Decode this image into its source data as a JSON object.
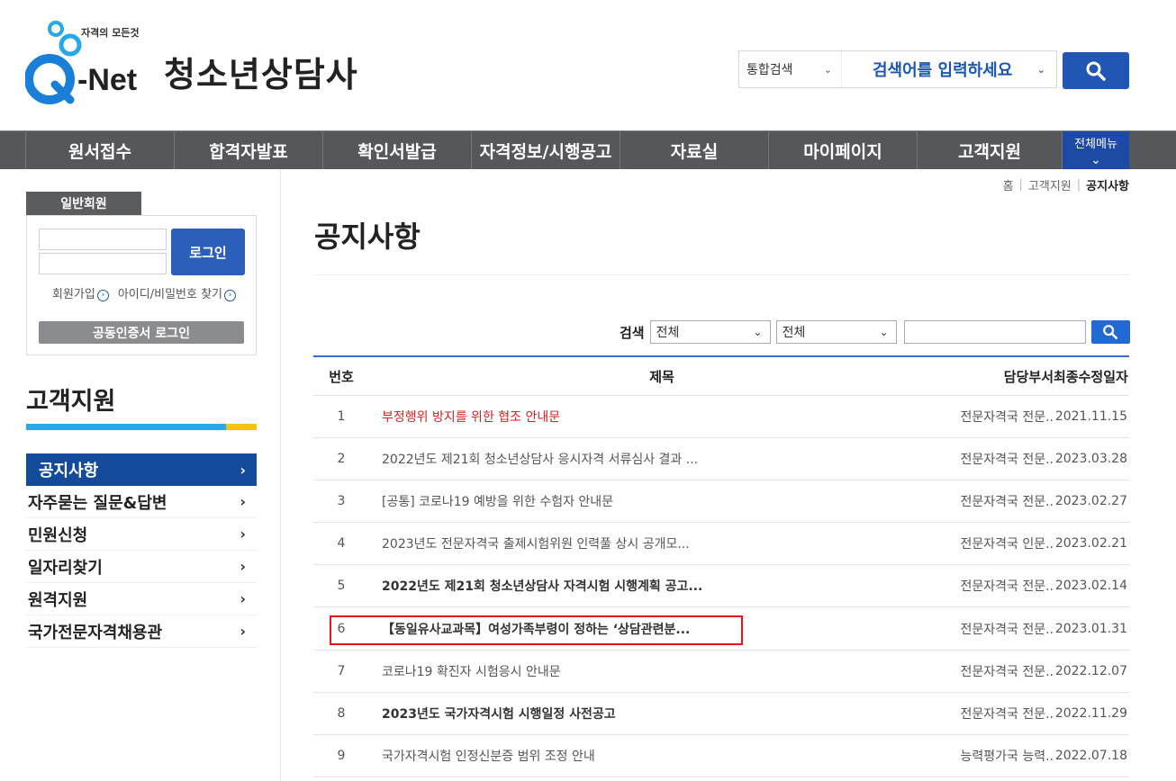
{
  "logo": {
    "tagline": "자격의 모든것",
    "wordmark": "Q-Net",
    "alt": "Q-Net"
  },
  "site_title": "청소년상담사",
  "search": {
    "scope": "통합검색",
    "placeholder": "검색어를 입력하세요"
  },
  "nav": {
    "items": [
      {
        "label": "원서접수"
      },
      {
        "label": "합격자발표"
      },
      {
        "label": "확인서발급"
      },
      {
        "label": "자격정보/시행공고"
      },
      {
        "label": "자료실"
      },
      {
        "label": "마이페이지"
      },
      {
        "label": "고객지원"
      }
    ],
    "all_menu": "전체메뉴"
  },
  "login": {
    "tab": "일반회원",
    "button": "로그인",
    "signup": "회원가입",
    "find": "아이디/비밀번호 찾기",
    "cert_login": "공동인증서 로그인"
  },
  "sidebar": {
    "title": "고객지원",
    "items": [
      {
        "label": "공지사항",
        "active": true
      },
      {
        "label": "자주묻는 질문&답변"
      },
      {
        "label": "민원신청"
      },
      {
        "label": "일자리찾기"
      },
      {
        "label": "원격지원"
      },
      {
        "label": "국가전문자격채용관"
      }
    ]
  },
  "breadcrumb": {
    "home": "홈",
    "parent": "고객지원",
    "current": "공지사항"
  },
  "page_title": "공지사항",
  "filter": {
    "label": "검색",
    "select1": "전체",
    "select2": "전체",
    "query": ""
  },
  "table": {
    "headers": {
      "no": "번호",
      "title": "제목",
      "dept": "담당부서",
      "date": "최종수정일자"
    },
    "rows": [
      {
        "no": "1",
        "title": "부정행위 방지를 위한 협조 안내문",
        "dept": "전문자격국 전문..",
        "date": "2021.11.15",
        "style": "red"
      },
      {
        "no": "2",
        "title": "2022년도 제21회 청소년상담사 응시자격 서류심사 결과 ...",
        "dept": "전문자격국 전문..",
        "date": "2023.03.28",
        "style": ""
      },
      {
        "no": "3",
        "title": "[공통] 코로나19 예방을 위한 수험자 안내문",
        "dept": "전문자격국 전문..",
        "date": "2023.02.27",
        "style": ""
      },
      {
        "no": "4",
        "title": "2023년도 전문자격국 출제시험위원 인력풀 상시 공개모...",
        "dept": "전문자격국 인문..",
        "date": "2023.02.21",
        "style": ""
      },
      {
        "no": "5",
        "title": "2022년도 제21회 청소년상담사 자격시험 시행계획 공고...",
        "dept": "전문자격국 전문..",
        "date": "2023.02.14",
        "style": "bold"
      },
      {
        "no": "6",
        "title": "【동일유사교과목】여성가족부령이 정하는 ‘상담관련분...",
        "dept": "전문자격국 전문..",
        "date": "2023.01.31",
        "style": "bold"
      },
      {
        "no": "7",
        "title": "코로나19 확진자 시험응시 안내문",
        "dept": "전문자격국 전문..",
        "date": "2022.12.07",
        "style": ""
      },
      {
        "no": "8",
        "title": "2023년도 국가자격시험 시행일정 사전공고",
        "dept": "전문자격국 전문..",
        "date": "2022.11.29",
        "style": "bold"
      },
      {
        "no": "9",
        "title": "국가자격시험 인정신분증 범위 조정 안내",
        "dept": "능력평가국 능력..",
        "date": "2022.07.18",
        "style": ""
      }
    ]
  },
  "colors": {
    "brand_blue": "#2056b4",
    "nav_gray": "#56575b",
    "accent_cyan": "#27a8e8",
    "accent_yellow": "#f5c211",
    "notice_red": "#d42222"
  }
}
